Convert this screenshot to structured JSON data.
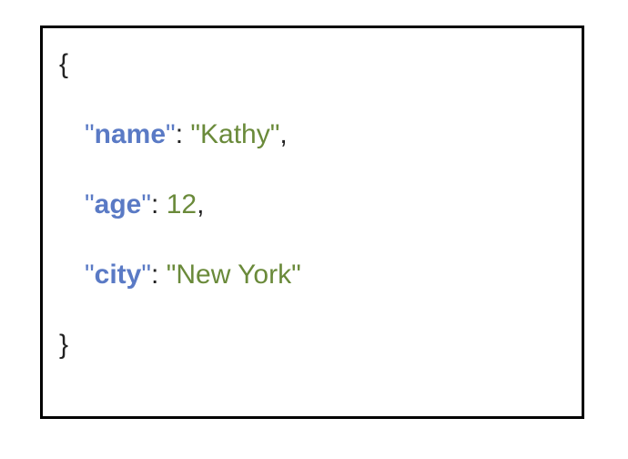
{
  "code": {
    "open_brace": "{",
    "close_brace": "}",
    "entries": [
      {
        "key": "name",
        "value": "Kathy",
        "type": "string",
        "trailing_comma": true
      },
      {
        "key": "age",
        "value": "12",
        "type": "number",
        "trailing_comma": true
      },
      {
        "key": "city",
        "value": "New York",
        "type": "string",
        "trailing_comma": false
      }
    ]
  }
}
